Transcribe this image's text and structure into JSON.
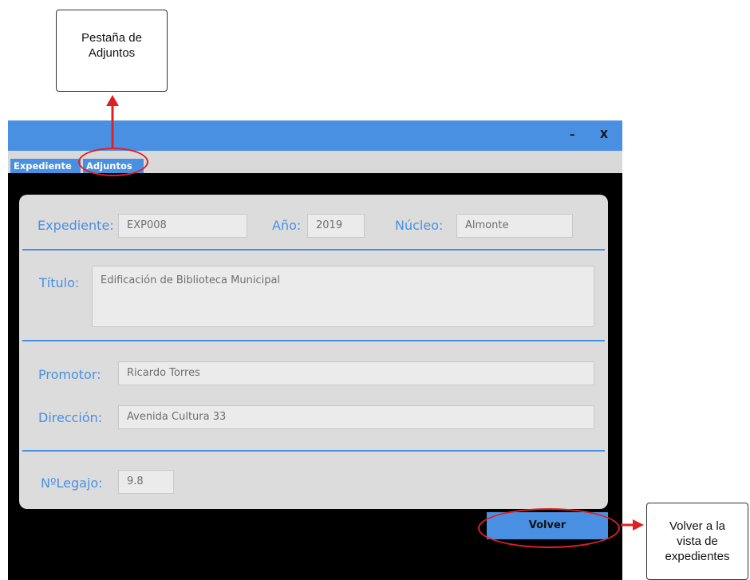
{
  "annotations": {
    "tabs_callout": "Pestaña de\nAdjuntos",
    "back_callout": "Volver a la\nvista de\nexpedientes",
    "highlight_color": "#e02020"
  },
  "window": {
    "minimize_label": "–",
    "close_label": "X",
    "accent_color": "#4a90e2"
  },
  "tabs": [
    {
      "label": "Expediente"
    },
    {
      "label": "Adjuntos"
    }
  ],
  "form": {
    "expediente": {
      "label": "Expediente:",
      "value": "EXP008"
    },
    "anio": {
      "label": "Año:",
      "value": "2019"
    },
    "nucleo": {
      "label": "Núcleo:",
      "value": "Almonte"
    },
    "titulo": {
      "label": "Título:",
      "value": "Edificación de Biblioteca Municipal"
    },
    "promotor": {
      "label": "Promotor:",
      "value": "Ricardo Torres"
    },
    "direccion": {
      "label": "Dirección:",
      "value": "Avenida Cultura 33"
    },
    "legajo": {
      "label": "NºLegajo:",
      "value": "9.8"
    }
  },
  "actions": {
    "back_label": "Volver"
  }
}
